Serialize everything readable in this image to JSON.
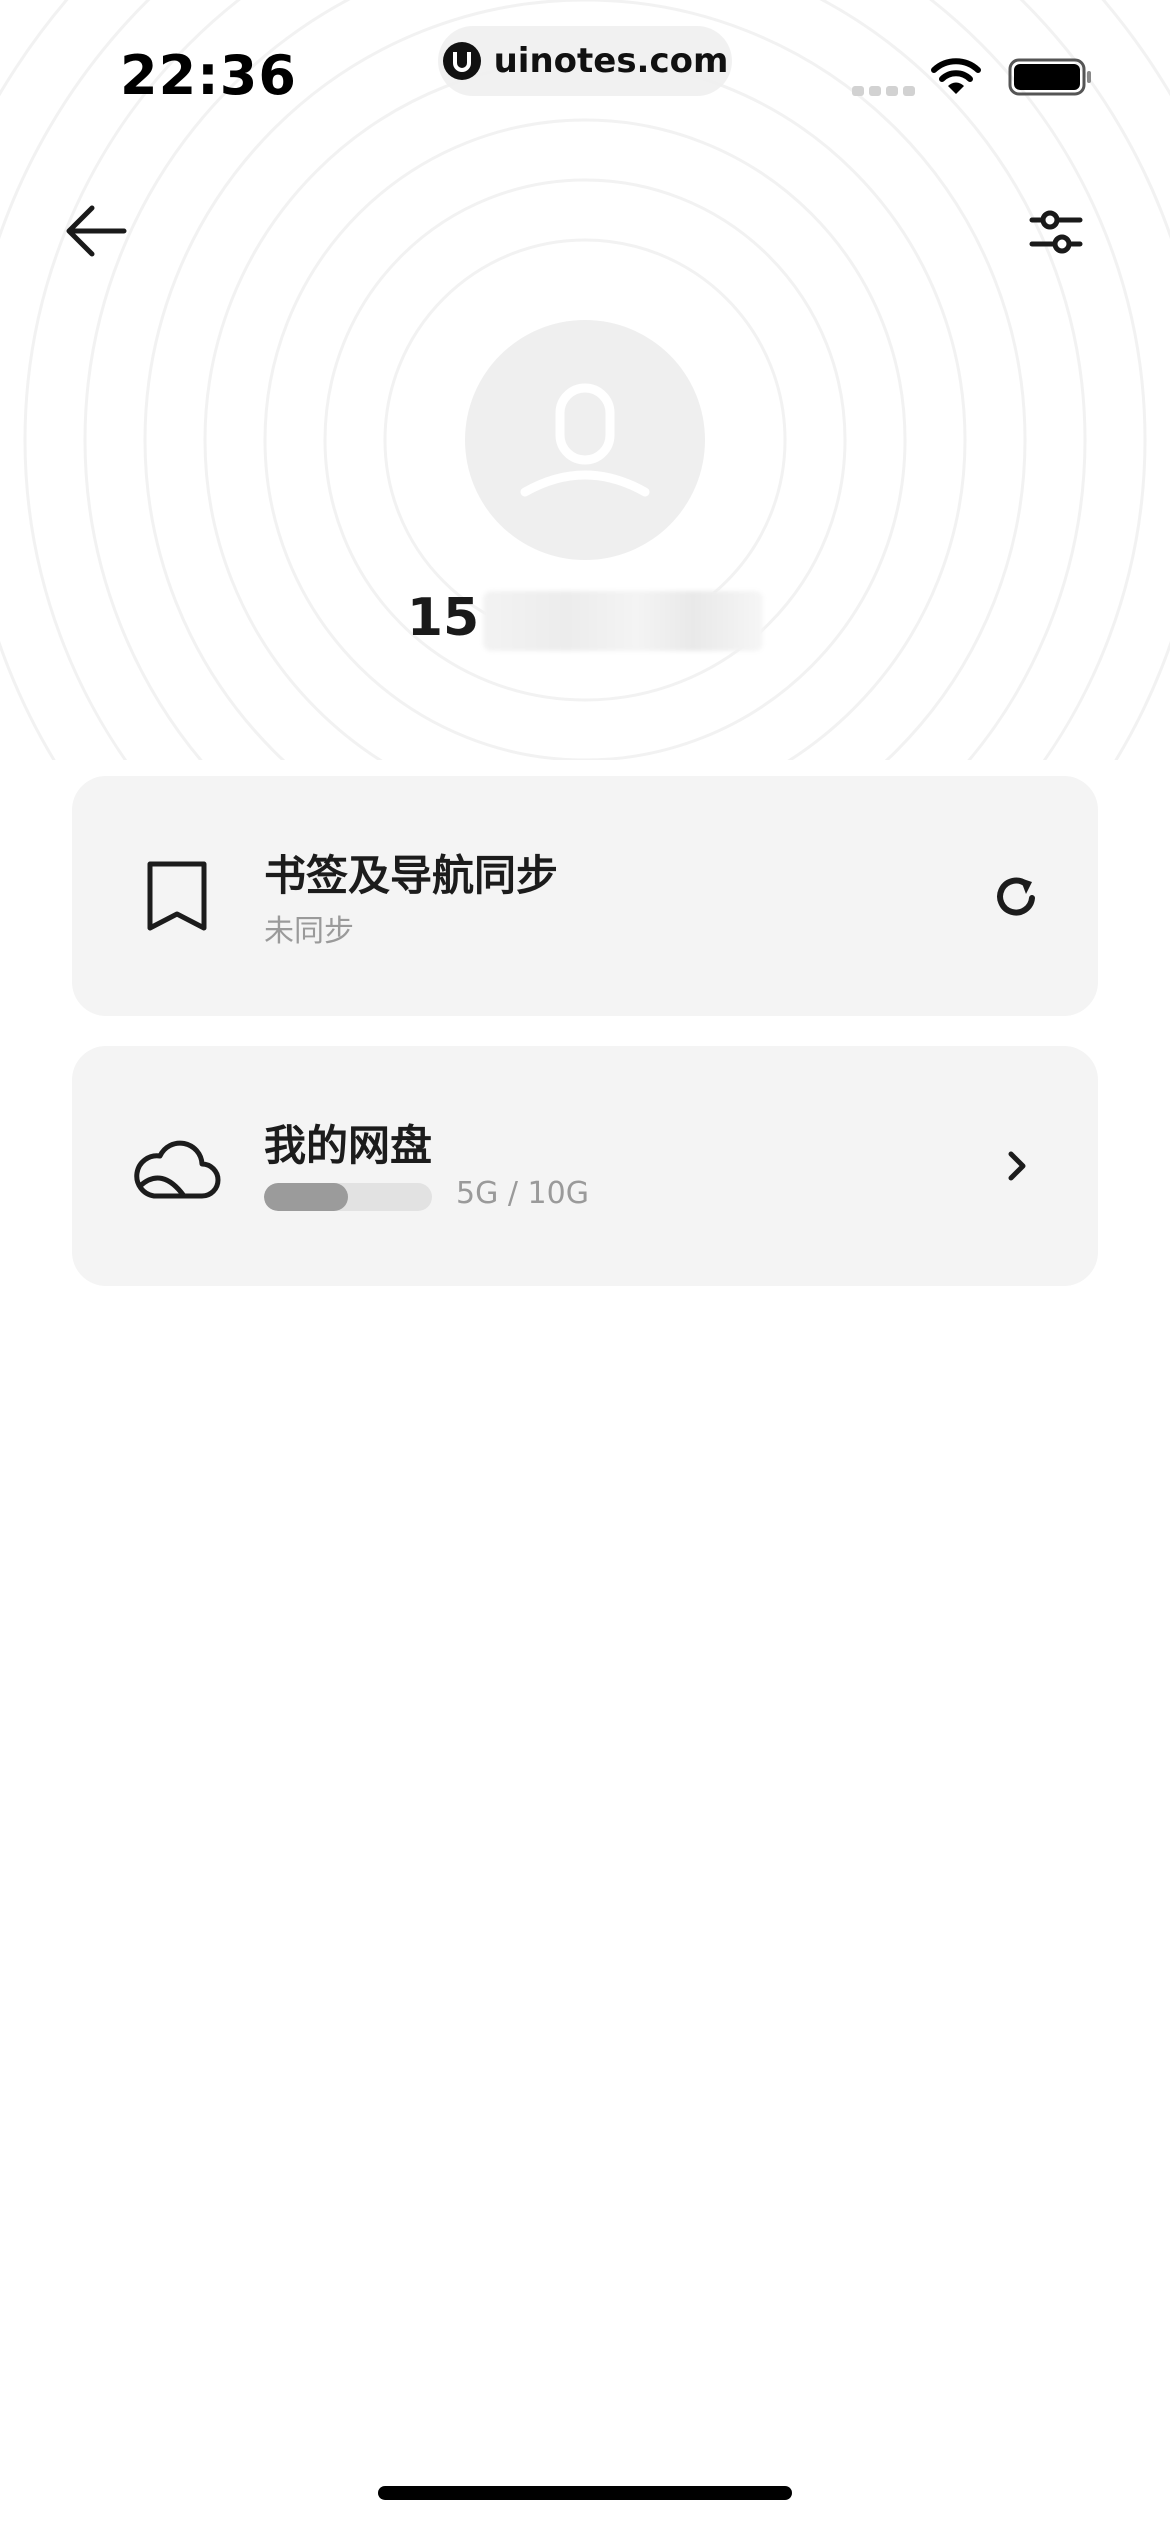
{
  "status_bar": {
    "time": "22:36",
    "site": "uinotes.com"
  },
  "profile": {
    "phone_prefix": "15"
  },
  "cards": {
    "sync": {
      "title": "书签及导航同步",
      "subtitle": "未同步",
      "icon": "bookmark-icon",
      "action_icon": "refresh-icon"
    },
    "disk": {
      "title": "我的网盘",
      "storage": "5G / 10G",
      "usage_fraction": 0.5,
      "icon": "cloud-icon",
      "action_icon": "chevron-right-icon"
    }
  },
  "colors": {
    "card_bg": "#f4f4f4",
    "progress_fill": "#9b9b9b",
    "progress_track": "#e2e2e2",
    "muted_text": "#9a9a9a"
  }
}
